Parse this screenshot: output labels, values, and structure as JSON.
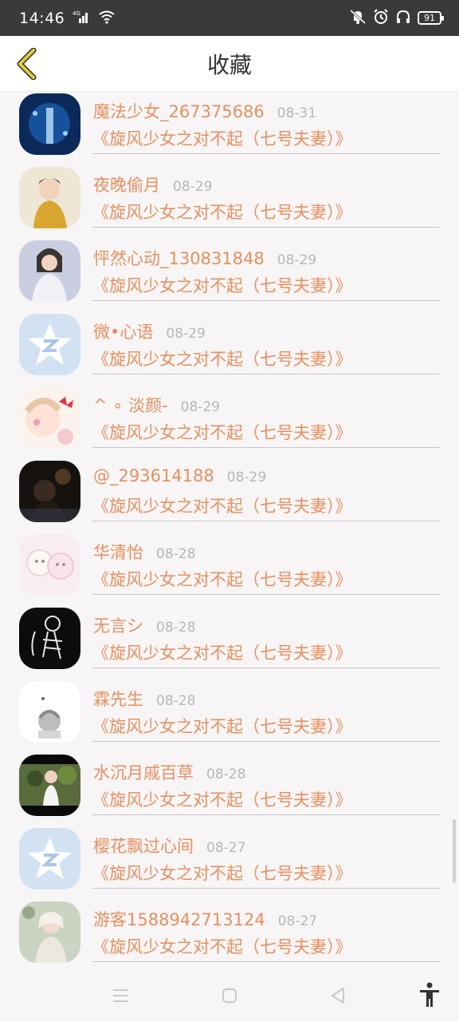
{
  "status_bar": {
    "time": "14:46",
    "network": "4G",
    "battery": "91"
  },
  "header": {
    "title": "收藏"
  },
  "items": [
    {
      "name": "魔法少女_267375686",
      "date": "08-31",
      "book": "《旋风少女之对不起（七号夫妻）》"
    },
    {
      "name": "夜晚偷月",
      "date": "08-29",
      "book": "《旋风少女之对不起（七号夫妻）》"
    },
    {
      "name": "怦然心动_130831848",
      "date": "08-29",
      "book": "《旋风少女之对不起（七号夫妻）》"
    },
    {
      "name": "微•心语",
      "date": "08-29",
      "book": "《旋风少女之对不起（七号夫妻）》"
    },
    {
      "name": "^ ∘ 淡颜-",
      "date": "08-29",
      "book": "《旋风少女之对不起（七号夫妻）》"
    },
    {
      "name": "@_293614188",
      "date": "08-29",
      "book": "《旋风少女之对不起（七号夫妻）》"
    },
    {
      "name": "华清怡",
      "date": "08-28",
      "book": "《旋风少女之对不起（七号夫妻）》"
    },
    {
      "name": "无言シ",
      "date": "08-28",
      "book": "《旋风少女之对不起（七号夫妻）》"
    },
    {
      "name": "霖先生",
      "date": "08-28",
      "book": "《旋风少女之对不起（七号夫妻）》"
    },
    {
      "name": "水沉月戚百草",
      "date": "08-28",
      "book": "《旋风少女之对不起（七号夫妻）》"
    },
    {
      "name": "樱花飘过心间",
      "date": "08-27",
      "book": "《旋风少女之对不起（七号夫妻）》"
    },
    {
      "name": "游客1588942713124",
      "date": "08-27",
      "book": "《旋风少女之对不起（七号夫妻）》"
    }
  ],
  "colors": {
    "accent": "#e98f5e",
    "date": "#b7b7b7",
    "back_arrow": "#e8c93a"
  }
}
